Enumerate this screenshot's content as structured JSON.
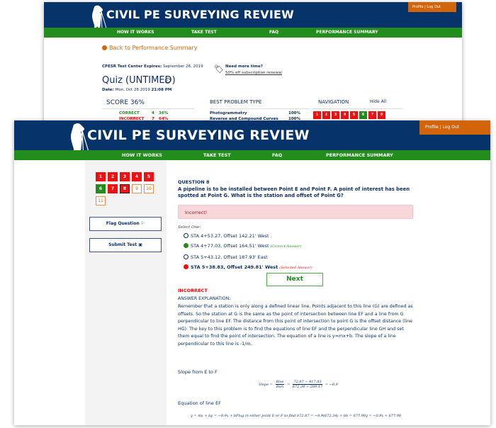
{
  "app": {
    "brand": "CIVIL PE SURVEYING REVIEW",
    "profile_label": "Profile",
    "separator": "|",
    "logout_label": "Log Out",
    "colors": {
      "header": "#06346a",
      "nav": "#228c1c",
      "accent": "#d2650a",
      "incorrect": "#ee1111",
      "correct": "#228c1c"
    }
  },
  "nav": {
    "items": [
      {
        "label": "HOW IT WORKS"
      },
      {
        "label": "TAKE TEST"
      },
      {
        "label": "FAQ"
      },
      {
        "label": "PERFORMANCE SUMMARY"
      }
    ]
  },
  "back_window": {
    "back_link": "Back to Performance Summary",
    "expires_label": "CPESR Test Center Expires:",
    "expires_value": "September 26, 2019",
    "quiz_title": "Quiz (UNTIMED)",
    "date_label": "Date:",
    "date_value": "Mon, Oct 28 2019",
    "time_value": "21:08 PM",
    "need_more_time": "Need more time?",
    "renewal_link": "50% off subscription renewal",
    "score_label": "SCORE 36%",
    "results": [
      {
        "label": "CORRECT",
        "count": "4",
        "pct": "36%"
      },
      {
        "label": "INCORRECT",
        "count": "7",
        "pct": "64%"
      }
    ],
    "best_problem_type_label": "BEST PROBLEM TYPE",
    "best_problem_types": [
      {
        "name": "Photogrammetry",
        "pct": "100%"
      },
      {
        "name": "Reverse and Compound Curves",
        "pct": "100%"
      }
    ],
    "navigation_label": "NAVIGATION",
    "hide_all_label": "Hide All",
    "nav_buttons": [
      {
        "n": "1",
        "state": "red"
      },
      {
        "n": "2",
        "state": "red"
      },
      {
        "n": "3",
        "state": "red"
      },
      {
        "n": "4",
        "state": "red"
      },
      {
        "n": "5",
        "state": "red"
      },
      {
        "n": "6",
        "state": "green"
      },
      {
        "n": "7",
        "state": "red"
      },
      {
        "n": "8",
        "state": "red"
      }
    ]
  },
  "sidebar": {
    "questions": [
      {
        "n": "1",
        "state": "red"
      },
      {
        "n": "2",
        "state": "red"
      },
      {
        "n": "3",
        "state": "red"
      },
      {
        "n": "4",
        "state": "red"
      },
      {
        "n": "5",
        "state": "red"
      },
      {
        "n": "6",
        "state": "green"
      },
      {
        "n": "7",
        "state": "red"
      },
      {
        "n": "8",
        "state": "current"
      },
      {
        "n": "9",
        "state": "open"
      },
      {
        "n": "10",
        "state": "open"
      },
      {
        "n": "11",
        "state": "open"
      }
    ],
    "flag_label": "Flag Question",
    "submit_label": "Submit Test"
  },
  "question": {
    "number_label": "QUESTION 8",
    "text": "A pipeline is to be installed between Point E and Point F. A point of interest has been spotted at Point G. What is the station and offset of Point G?",
    "alert": "Incorrect!",
    "select_one": "Select One:",
    "options": [
      {
        "label": "STA 4+53.27, Offset 142.21' West",
        "note": "",
        "state": "empty"
      },
      {
        "label": "STA 4+77.03, Offset 164.51' West",
        "note": "(Correct Answer)",
        "state": "correct"
      },
      {
        "label": "STA 5+43.12, Offset 187.93' East",
        "note": "",
        "state": "empty"
      },
      {
        "label": "STA 5+38.83, Offset 249.81' West",
        "note": "(Selected Answer)",
        "state": "selected"
      }
    ],
    "next_label": "Next",
    "result_label": "INCORRECT",
    "explanation_heading": "ANSWER EXPLANATION:",
    "explanation": "Remember that a station is only along a defined linear line. Points adjacent to this line (G) are defined as offsets. So the station at G is the same as the point of intersection between line EF and a line from G perpendicular to line EF. The distance from this point of intersection to point G is the offset distance (line HG). The key to this problem is to find the equations of line EF and the perpendicular line GH and set them equal to find the point of intersection. The equation of a line is y=mx+b. The slope of a line perpendicular to this line is -1/m.",
    "slope_heading": "Slope from E to F",
    "slope_formula": {
      "lhs": "Slope =",
      "frac1_num": "Rise",
      "frac1_den": "Run",
      "eq": "=",
      "frac2_num": "72.87 − 417.83",
      "frac2_den": "672.34 − 289.17",
      "result": "= −0.9"
    },
    "equation_heading": "Equation of line EF",
    "equation_formula": "y = mx + by = −0.9x + bPlug in either point E or F to find b72.87 = −0.9(672.34) + bb = 677.98y = −0.9x + 677.98"
  }
}
